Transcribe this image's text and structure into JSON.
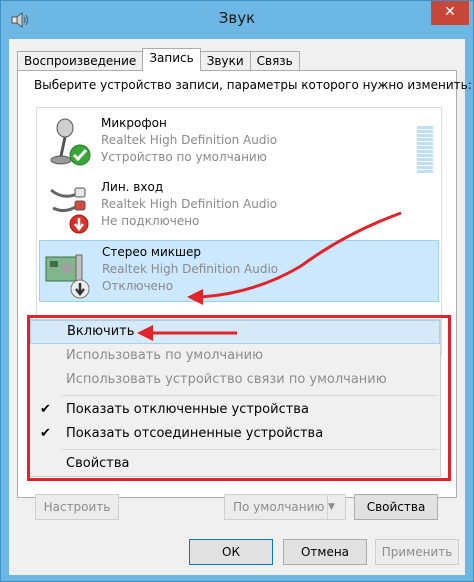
{
  "window": {
    "title": "Звук",
    "close_glyph": "✕"
  },
  "tabs": [
    {
      "label": "Воспроизведение"
    },
    {
      "label": "Запись"
    },
    {
      "label": "Звуки"
    },
    {
      "label": "Связь"
    }
  ],
  "instruction": "Выберите устройство записи, параметры которого нужно изменить:",
  "devices": [
    {
      "name": "Микрофон",
      "driver": "Realtek High Definition Audio",
      "status": "Устройство по умолчанию",
      "icon": "microphone-icon",
      "badge": "check-badge-icon"
    },
    {
      "name": "Лин. вход",
      "driver": "Realtek High Definition Audio",
      "status": "Не подключено",
      "icon": "line-in-cable-icon",
      "badge": "red-down-arrow-badge-icon"
    },
    {
      "name": "Стерео микшер",
      "driver": "Realtek High Definition Audio",
      "status": "Отключено",
      "icon": "sound-card-icon",
      "badge": "disabled-down-arrow-badge-icon"
    }
  ],
  "context_menu": {
    "enable": "Включить",
    "set_default": "Использовать по умолчанию",
    "set_default_comm": "Использовать устройство связи по умолчанию",
    "show_disabled": "Показать отключенные устройства",
    "show_disconnected": "Показать отсоединенные устройства",
    "properties": "Свойства",
    "check_glyph": "✔"
  },
  "panel_buttons": {
    "configure": "Настроить",
    "default": "По умолчанию",
    "properties": "Свойства"
  },
  "dialog_buttons": {
    "ok": "ОК",
    "cancel": "Отмена",
    "apply": "Применить"
  },
  "colors": {
    "annotation_red": "#e2232a",
    "selection_blue": "#cce8ff",
    "title_bar": "#6cb7e3"
  }
}
